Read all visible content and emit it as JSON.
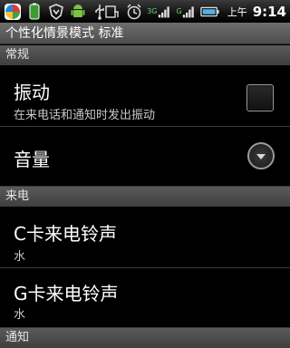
{
  "status_bar": {
    "time": "9:14",
    "ampm": "上午",
    "net_3g": "3G",
    "net_g": "G"
  },
  "title": "个性化情景模式 标准",
  "sections": {
    "general": "常规",
    "incoming": "来电",
    "notification": "通知"
  },
  "prefs": {
    "vibrate": {
      "title": "振动",
      "summary": "在来电话和通知时发出振动",
      "checked": false
    },
    "volume": {
      "title": "音量"
    },
    "c_ringtone": {
      "title": "C卡来电铃声",
      "summary": "水"
    },
    "g_ringtone": {
      "title": "G卡来电铃声",
      "summary": "水"
    }
  }
}
